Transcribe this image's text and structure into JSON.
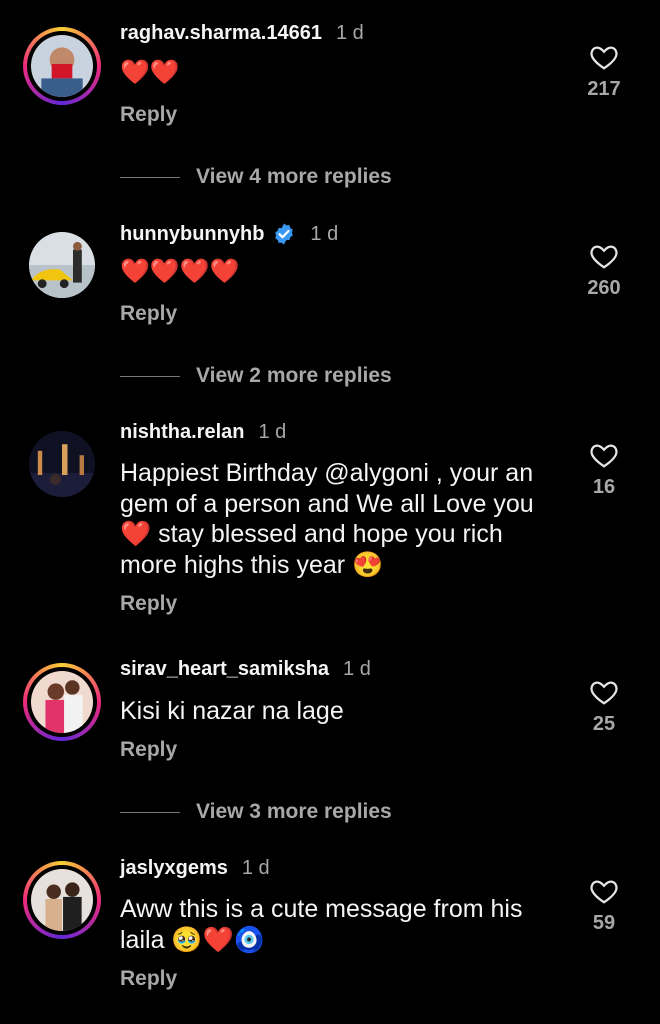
{
  "comments": [
    {
      "username": "raghav.sharma.14661",
      "time": "1 d",
      "text": "❤️❤️",
      "reply": "Reply",
      "likes": "217",
      "verified": false
    },
    {
      "username": "hunnybunnyhb",
      "time": "1 d",
      "text": "❤️❤️❤️❤️",
      "reply": "Reply",
      "likes": "260",
      "verified": true
    },
    {
      "username": "nishtha.relan",
      "time": "1 d",
      "text_lines": [
        "Happiest Birthday @alygoni , your an",
        "gem of a person and We all Love you",
        "❤️ stay blessed and hope you rich",
        "more highs this year 😍"
      ],
      "reply": "Reply",
      "likes": "16",
      "verified": false
    },
    {
      "username": "sirav_heart_samiksha",
      "time": "1 d",
      "text": "Kisi ki nazar na lage",
      "reply": "Reply",
      "likes": "25",
      "verified": false
    },
    {
      "username": "jaslyxgems",
      "time": "1 d",
      "text_lines": [
        "Aww this is a cute message from his",
        "laila 🥹❤️🧿"
      ],
      "reply": "Reply",
      "likes": "59",
      "verified": false
    }
  ],
  "view_more": [
    "View 4 more replies",
    "View 2 more replies",
    "View 3 more replies"
  ],
  "colors": {
    "background": "#000000",
    "ring_gradient": [
      "#f9ce34",
      "#ee2a7b",
      "#6228d7"
    ],
    "verified": "#3897f0",
    "muted": "#a8a8a8"
  }
}
